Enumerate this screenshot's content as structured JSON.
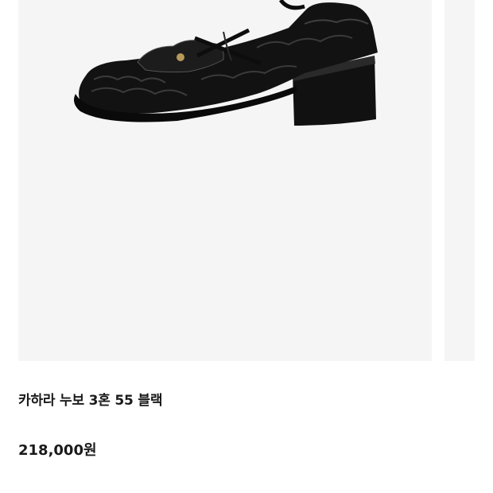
{
  "product": {
    "title": "카하라 누보 3혼 55 블랙",
    "price": "218,000원"
  },
  "gallery": {
    "current_image": "black-leather-loafer-photo",
    "next_image_peek": true
  },
  "colors": {
    "image_background": "#f5f5f5",
    "text": "#1a1a1a"
  }
}
